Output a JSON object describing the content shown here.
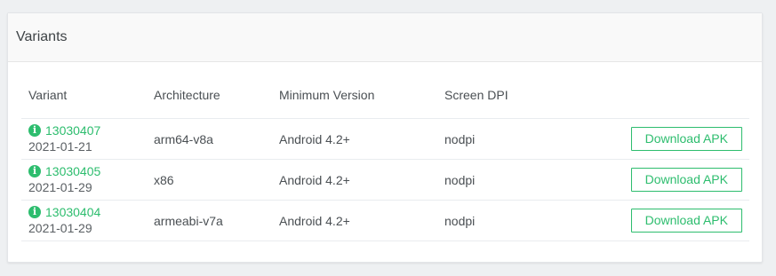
{
  "card": {
    "title": "Variants"
  },
  "table": {
    "headers": [
      "Variant",
      "Architecture",
      "Minimum Version",
      "Screen DPI"
    ],
    "rows": [
      {
        "variant": "13030407",
        "date": "2021-01-21",
        "architecture": "arm64-v8a",
        "min_version": "Android 4.2+",
        "dpi": "nodpi",
        "download_label": "Download APK"
      },
      {
        "variant": "13030405",
        "date": "2021-01-29",
        "architecture": "x86",
        "min_version": "Android 4.2+",
        "dpi": "nodpi",
        "download_label": "Download APK"
      },
      {
        "variant": "13030404",
        "date": "2021-01-29",
        "architecture": "armeabi-v7a",
        "min_version": "Android 4.2+",
        "dpi": "nodpi",
        "download_label": "Download APK"
      }
    ]
  },
  "icons": {
    "info": "info-icon"
  },
  "colors": {
    "accent": "#2dbd6e",
    "text": "#4a4f53",
    "header_bg": "#f9f9f9"
  }
}
